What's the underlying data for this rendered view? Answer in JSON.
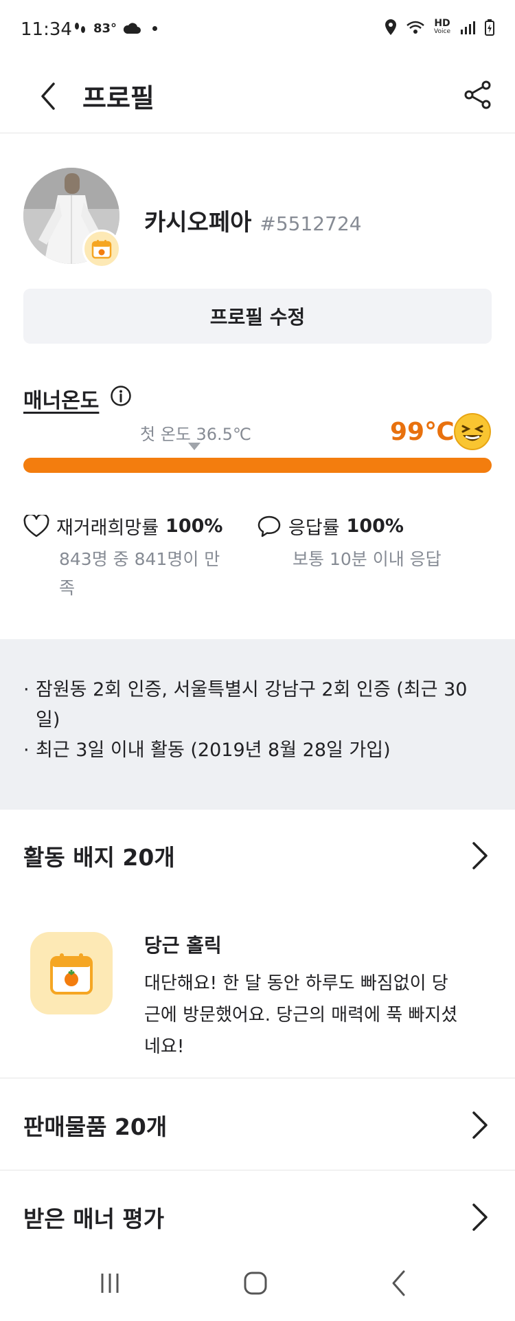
{
  "status_bar": {
    "time": "11:34",
    "weather_temp": "83°",
    "network": "HD",
    "network_sub": "Voice"
  },
  "header": {
    "title": "프로필"
  },
  "profile": {
    "name": "카시오페아",
    "user_id": "#5512724",
    "edit_button": "프로필 수정"
  },
  "manner": {
    "label": "매너온도",
    "first_temp": "첫 온도 36.5℃",
    "temperature": "99℃",
    "temperature_value": 99,
    "accent_color": "#f37d0e"
  },
  "rates": {
    "retrade": {
      "label": "재거래희망률",
      "value": "100%",
      "detail": "843명 중 841명이 만족",
      "icon": "heart-icon"
    },
    "response": {
      "label": "응답률",
      "value": "100%",
      "detail": "보통 10분 이내 응답",
      "icon": "chat-bubble-icon"
    }
  },
  "info": {
    "items": [
      "잠원동 2회 인증, 서울특별시 강남구 2회 인증 (최근 30일)",
      "최근 3일 이내 활동 (2019년 8월 28일 가입)"
    ]
  },
  "badges_section": {
    "title": "활동 배지 20개",
    "badge_title": "당근 홀릭",
    "badge_desc": "대단해요! 한 달 동안 하루도 빠짐없이 당근에 방문했어요. 당근의 매력에 푹 빠지셨네요!"
  },
  "sales_section": {
    "title": "판매물품 20개"
  },
  "manners_section": {
    "title": "받은 매너 평가"
  }
}
